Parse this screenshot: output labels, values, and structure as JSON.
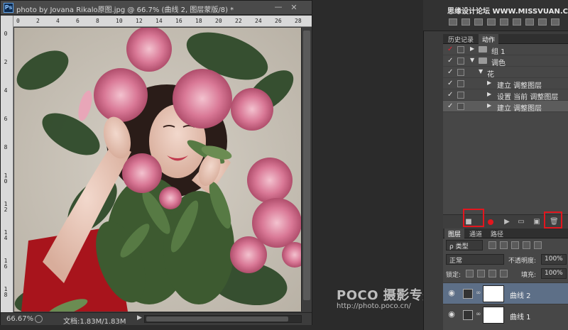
{
  "document": {
    "title": "photo by Jovana Rikalo原图.jpg @ 66.7% (曲线 2, 图层蒙版/8) *",
    "minimize": "—",
    "close": "✕",
    "ruler_top_labels": [
      "0",
      "2",
      "4",
      "6",
      "8",
      "10",
      "12",
      "14",
      "16",
      "18",
      "20",
      "22",
      "24",
      "26",
      "28"
    ],
    "ruler_left_labels": [
      "0",
      "2",
      "4",
      "6",
      "8",
      "1\n0",
      "1\n2",
      "1\n4",
      "1\n6",
      "1\n8"
    ],
    "zoom": "66.67%",
    "doc_size": "文档:1.83M/1.83M",
    "status_arrow": "▶"
  },
  "watermark_top": "思缘设计论坛 WWW.MISSVUAN.COM",
  "history_panel": {
    "tabs": [
      {
        "label": "历史记录",
        "active": false
      },
      {
        "label": "动作",
        "active": true
      }
    ]
  },
  "actions": [
    {
      "check": "✓",
      "label": "组 1",
      "kind": "set",
      "expanded": false,
      "indent": 0,
      "check_color": "red"
    },
    {
      "check": "✓",
      "label": "调色",
      "kind": "set",
      "expanded": true,
      "indent": 0,
      "check_color": "normal"
    },
    {
      "check": "✓",
      "label": "花",
      "kind": "action",
      "expanded": true,
      "indent": 1,
      "check_color": "normal"
    },
    {
      "check": "✓",
      "label": "建立 调整图层",
      "kind": "step",
      "expanded": false,
      "indent": 2,
      "check_color": "normal"
    },
    {
      "check": "✓",
      "label": "设置 当前 调整图层",
      "kind": "step",
      "expanded": false,
      "indent": 2,
      "check_color": "normal"
    },
    {
      "check": "✓",
      "label": "建立 调整图层",
      "kind": "step",
      "expanded": false,
      "indent": 2,
      "check_color": "normal",
      "selected": true
    }
  ],
  "actions_bottom": {
    "stop": "■",
    "play": "▶",
    "new_set": "▭",
    "new_action": "▣",
    "delete": "🗑"
  },
  "layers_panel": {
    "tabs": [
      {
        "label": "图层",
        "active": true
      },
      {
        "label": "通道",
        "active": false
      },
      {
        "label": "路径",
        "active": false
      }
    ],
    "filter": "ρ 类型",
    "blend_mode": "正常",
    "opacity_label": "不透明度:",
    "opacity_value": "100%",
    "lock_label": "锁定:",
    "fill_label": "填充:",
    "fill_value": "100%",
    "layers": [
      {
        "name": "曲线 2",
        "selected": true
      },
      {
        "name": "曲线 1",
        "selected": false
      }
    ]
  },
  "poco_watermark": {
    "brand": "POCO 摄影专题",
    "url": "http://photo.poco.cn/"
  }
}
